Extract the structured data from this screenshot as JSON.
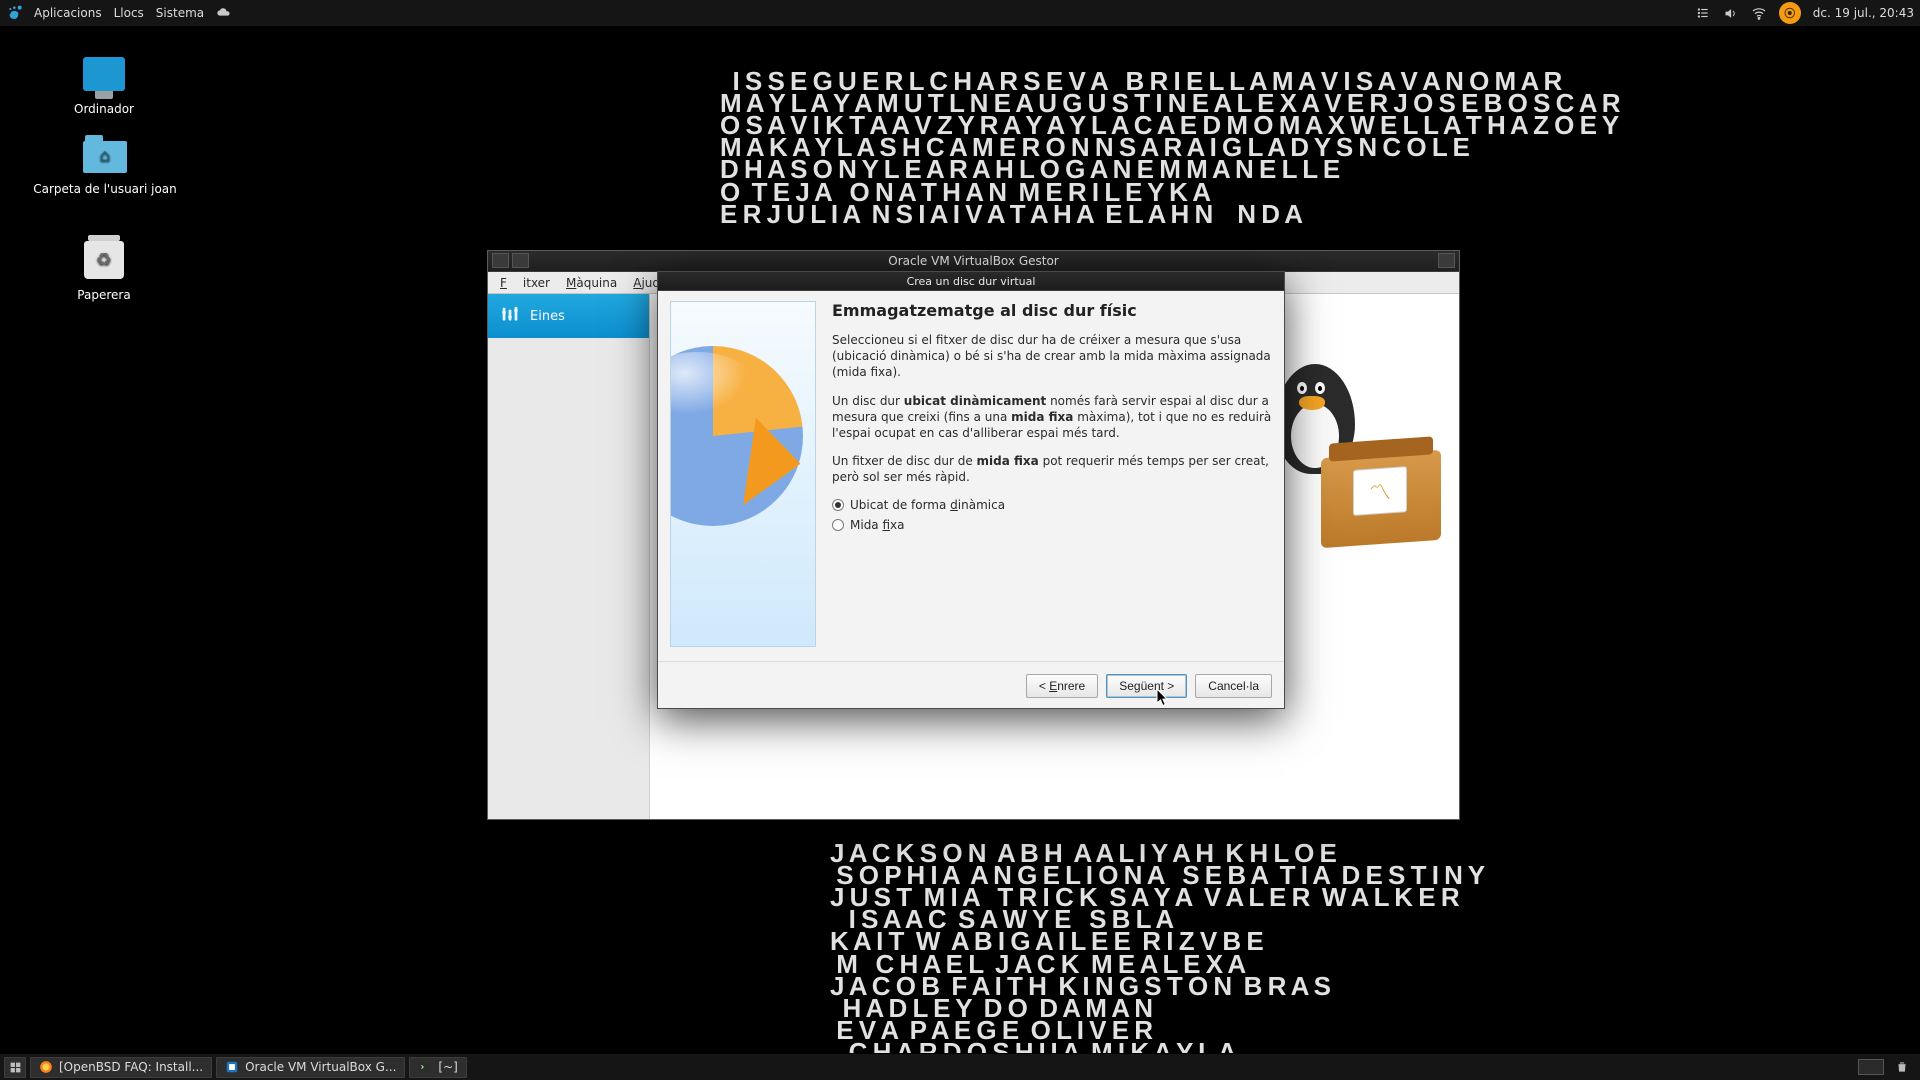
{
  "taskbar_top": {
    "menu_apps": "Aplicacions",
    "menu_places": "Llocs",
    "menu_system": "Sistema",
    "clock": "dc. 19 jul., 20:43"
  },
  "desktop": {
    "computer": "Ordinador",
    "home": "Carpeta de l'usuari joan",
    "trash": "Paperera"
  },
  "vbm": {
    "title": "Oracle VM VirtualBox Gestor",
    "menu_file": "Fitxer",
    "menu_machine": "Màquina",
    "menu_help": "Ajuda",
    "tool_item": "Eines"
  },
  "wizard": {
    "title": "Crea un disc dur virtual",
    "heading": "Emmagatzematge al disc dur físic",
    "p1": "Seleccioneu si el fitxer de disc dur ha de créixer a mesura que s'usa (ubicació dinàmica) o bé si s'ha de crear amb la mida màxima assignada (mida fixa).",
    "p2a": "Un disc dur ",
    "p2b": "ubicat dinàmicament",
    "p2c": " només farà servir espai al disc dur a mesura que creixi (fins a una ",
    "p2d": "mida fixa",
    "p2e": " màxima), tot i que no es reduirà l'espai ocupat en cas d'alliberar espai més tard.",
    "p3a": "Un fitxer de disc dur de ",
    "p3b": "mida fixa",
    "p3c": " pot requerir més temps per ser creat, però sol ser més ràpid.",
    "opt_dynamic_pre": "Ubicat de forma ",
    "opt_dynamic_u": "d",
    "opt_dynamic_post": "inàmica",
    "opt_fixed_pre": "Mida ",
    "opt_fixed_u": "f",
    "opt_fixed_post": "ixa",
    "btn_back_pre": "< ",
    "btn_back_u": "E",
    "btn_back_post": "nrere",
    "btn_next_pre": "Se",
    "btn_next_u": "g",
    "btn_next_post": "üent >",
    "btn_cancel": "Cancel·la"
  },
  "taskbar_bottom": {
    "task1": "[OpenBSD FAQ: Install...",
    "task2": "Oracle VM VirtualBox G...",
    "task3": "[~]"
  }
}
